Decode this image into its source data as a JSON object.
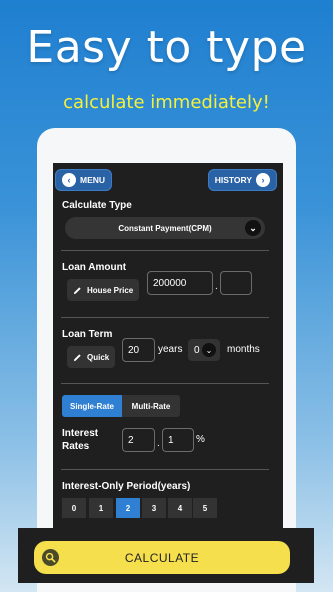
{
  "promo": {
    "headline": "Easy to type",
    "subline": "calculate immediately!"
  },
  "nav": {
    "menu_label": "MENU",
    "history_label": "HISTORY"
  },
  "calculate_type": {
    "label": "Calculate Type",
    "selected": "Constant Payment(CPM)"
  },
  "loan_amount": {
    "label": "Loan Amount",
    "quick_button": "House Price",
    "value": "200000",
    "decimal_separator": ".",
    "decimal_value": ""
  },
  "loan_term": {
    "label": "Loan Term",
    "quick_button": "Quick",
    "years_value": "20",
    "years_unit": "years",
    "months_value": "0",
    "months_unit": "months"
  },
  "rate_mode": {
    "options": [
      "Single-Rate",
      "Multi-Rate"
    ],
    "selected": "Single-Rate"
  },
  "interest": {
    "label_line1": "Interest",
    "label_line2": "Rates",
    "int_value": "2",
    "separator": ".",
    "dec_value": "1",
    "unit": "%"
  },
  "interest_only": {
    "label": "Interest-Only Period(years)",
    "options": [
      "0",
      "1",
      "2",
      "3",
      "4",
      "5"
    ],
    "selected": "2"
  },
  "calculate_button": "CALCULATE",
  "colors": {
    "accent_blue": "#2f7fd3",
    "button_yellow": "#f5df4d",
    "headline_yellow": "#f6f03a",
    "screen_bg": "#1f1f1f"
  }
}
